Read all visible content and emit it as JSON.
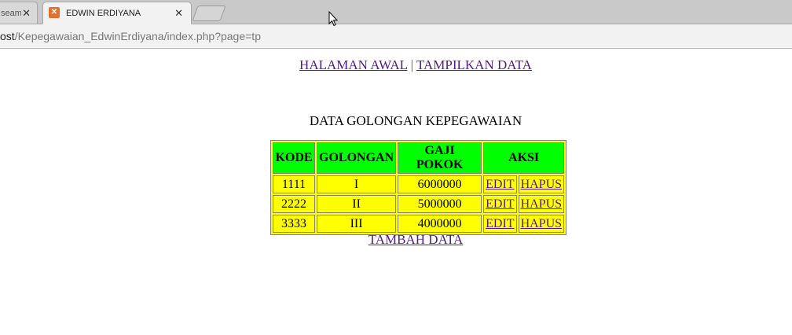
{
  "browser": {
    "prev_tab_title": "seam",
    "active_tab_title": "EDWIN ERDIYANA",
    "url_host": "ost",
    "url_path": "/Kepegawaian_EdwinErdiyana/index.php?page=tp",
    "close_glyph": "✕"
  },
  "nav": {
    "home_label": "HALAMAN AWAL",
    "separator": "|",
    "show_data_label": "TAMPILKAN DATA"
  },
  "page": {
    "title": "DATA GOLONGAN KEPEGAWAIAN",
    "add_label": "TAMBAH DATA"
  },
  "table": {
    "headers": [
      "KODE",
      "GOLONGAN",
      "GAJI POKOK",
      "AKSI"
    ],
    "rows": [
      {
        "kode": "1111",
        "golongan": "I",
        "gaji": "6000000",
        "edit": "EDIT",
        "hapus": "HAPUS"
      },
      {
        "kode": "2222",
        "golongan": "II",
        "gaji": "5000000",
        "edit": "EDIT",
        "hapus": "HAPUS"
      },
      {
        "kode": "3333",
        "golongan": "III",
        "gaji": "4000000",
        "edit": "EDIT",
        "hapus": "HAPUS"
      }
    ]
  },
  "colors": {
    "header_bg": "#00ff00",
    "cell_bg": "#ffff00",
    "link": "#551a8b"
  }
}
